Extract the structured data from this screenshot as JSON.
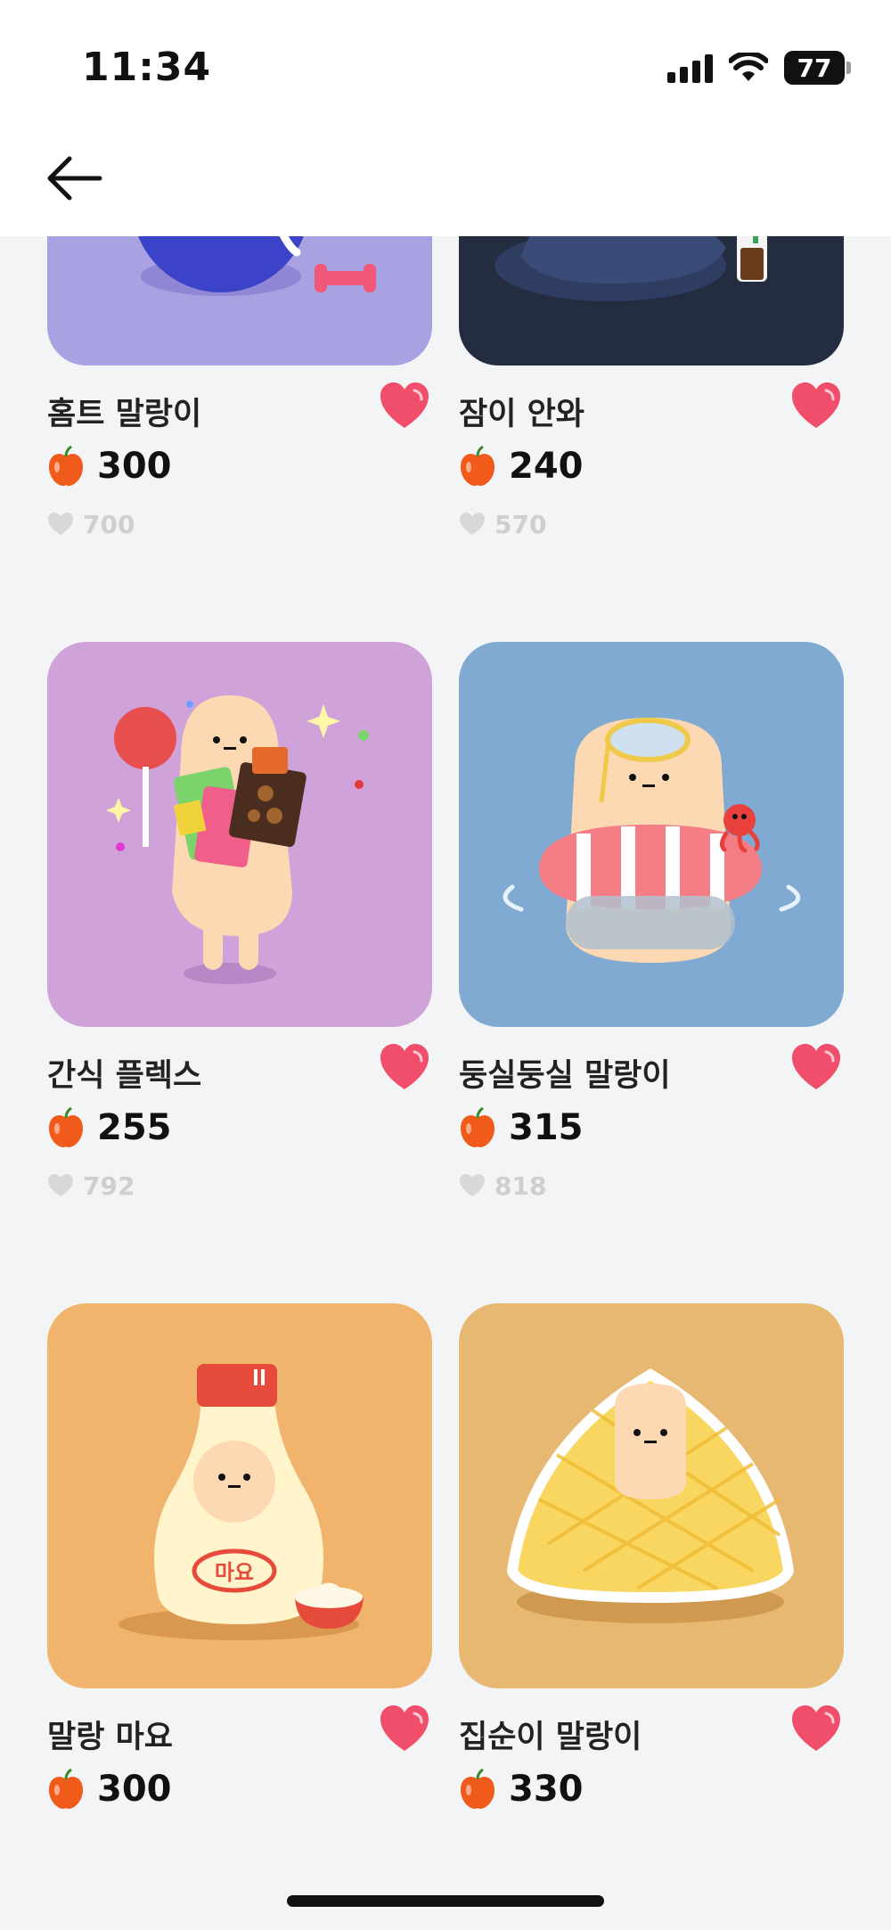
{
  "status_bar": {
    "time": "11:34",
    "battery": "77"
  },
  "header": {
    "back_icon": "arrow-left-icon"
  },
  "colors": {
    "heart": "#f04e6a",
    "apple": "#f05a1a",
    "likes": "#cfcfcf"
  },
  "items": [
    {
      "name": "홈트 말랑이",
      "price": "300",
      "likes": "700",
      "bg": "#a8a1e2"
    },
    {
      "name": "잠이 안와",
      "price": "240",
      "likes": "570",
      "bg": "#242c40"
    },
    {
      "name": "간식 플렉스",
      "price": "255",
      "likes": "792",
      "bg": "#cfa2d9"
    },
    {
      "name": "둥실둥실 말랑이",
      "price": "315",
      "likes": "818",
      "bg": "#81aad3"
    },
    {
      "name": "말랑 마요",
      "price": "300",
      "bg": "#f0b46c",
      "label": "마요"
    },
    {
      "name": "집순이 말랑이",
      "price": "330",
      "bg": "#e6b872"
    }
  ]
}
